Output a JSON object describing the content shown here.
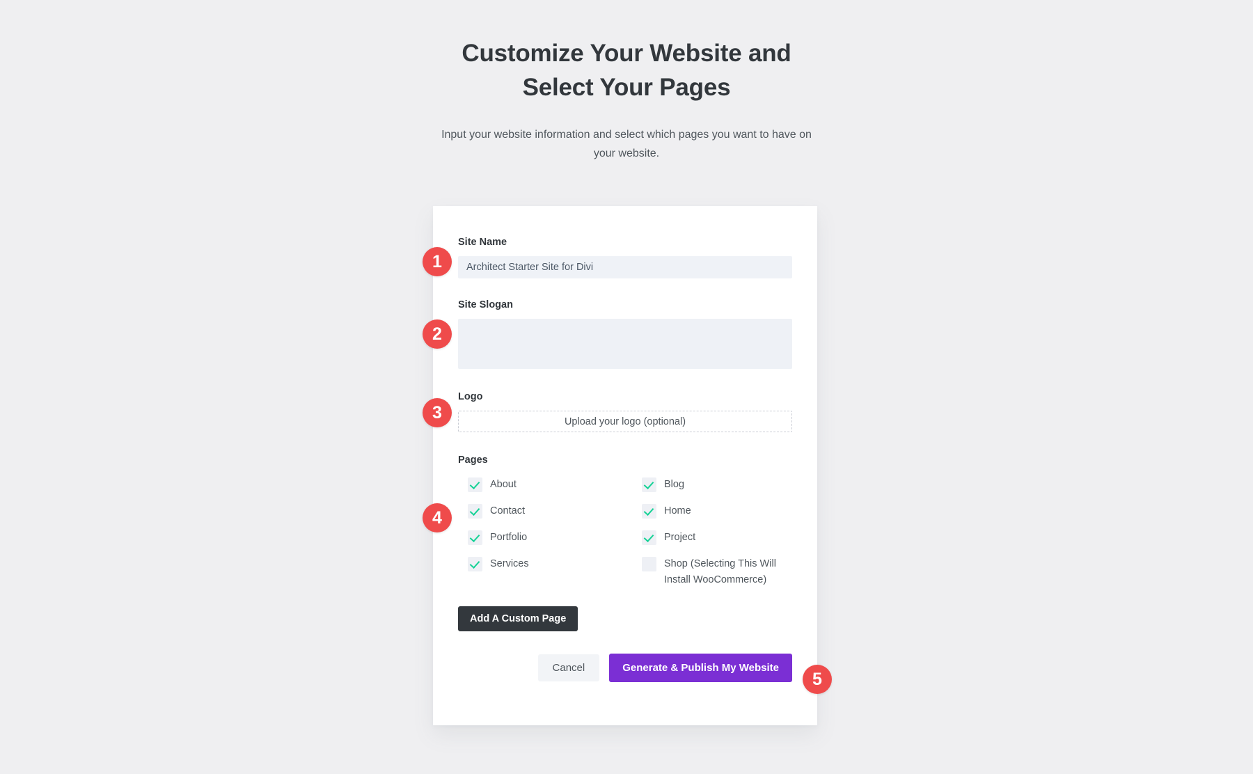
{
  "header": {
    "title": "Customize Your Website and Select Your Pages",
    "subtitle": "Input your website information and select which pages you want to have on your website."
  },
  "form": {
    "site_name": {
      "label": "Site Name",
      "value": "Architect Starter Site for Divi",
      "placeholder": ""
    },
    "site_slogan": {
      "label": "Site Slogan",
      "value": "",
      "placeholder": ""
    },
    "logo": {
      "label": "Logo",
      "upload_text": "Upload your logo (optional)"
    },
    "pages": {
      "label": "Pages",
      "items": [
        {
          "label": "About",
          "checked": true
        },
        {
          "label": "Blog",
          "checked": true
        },
        {
          "label": "Contact",
          "checked": true
        },
        {
          "label": "Home",
          "checked": true
        },
        {
          "label": "Portfolio",
          "checked": true
        },
        {
          "label": "Project",
          "checked": true
        },
        {
          "label": "Services",
          "checked": true
        },
        {
          "label": "Shop (Selecting This Will Install WooCommerce)",
          "checked": false
        }
      ]
    },
    "add_custom_page_label": "Add A Custom Page",
    "cancel_label": "Cancel",
    "publish_label": "Generate & Publish My Website"
  },
  "badges": [
    {
      "number": "1"
    },
    {
      "number": "2"
    },
    {
      "number": "3"
    },
    {
      "number": "4"
    },
    {
      "number": "5"
    }
  ],
  "colors": {
    "page_background": "#efeff1",
    "card_background": "#ffffff",
    "badge_red": "#ef4b4b",
    "publish_purple": "#7b2fd4",
    "dark_button": "#33383d",
    "check_green": "#16d296",
    "input_background": "#eff2f7",
    "heading_text": "#32373c",
    "body_text": "#4f565c"
  }
}
